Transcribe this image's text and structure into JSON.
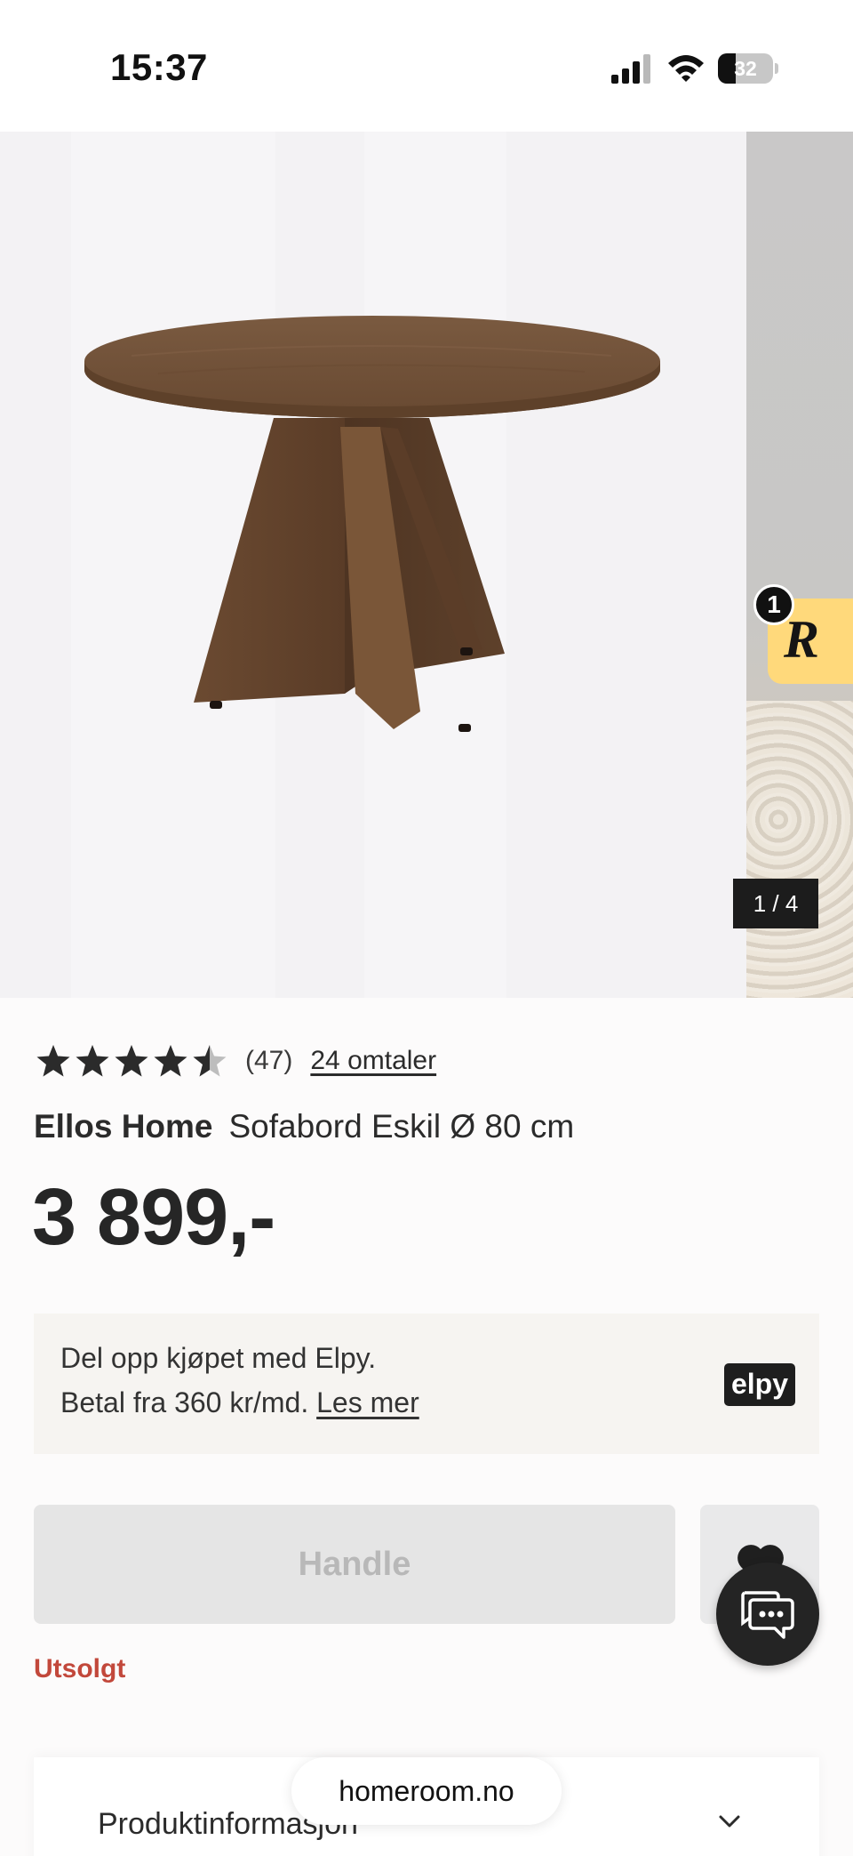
{
  "status_bar": {
    "time": "15:37",
    "battery_level": "32",
    "battery_fraction": 0.32,
    "icons": [
      "signal-icon",
      "wifi-icon",
      "battery-icon"
    ]
  },
  "gallery": {
    "counter": "1 / 4",
    "reco_badge_count": "1",
    "reco_logo": "R"
  },
  "rating": {
    "stars": 4.5,
    "count_text": "(47)",
    "reviews_link": "24 omtaler"
  },
  "product": {
    "brand": "Ellos Home",
    "name": "Sofabord Eskil Ø 80 cm",
    "price": "3 899,-"
  },
  "financing": {
    "line1": "Del opp kjøpet med Elpy.",
    "line2": "Betal fra 360 kr/md.",
    "link": "Les mer",
    "logo_text": "elpy"
  },
  "actions": {
    "buy_label": "Handle",
    "stock_status": "Utsolgt"
  },
  "info_section": {
    "title": "Produktinformasjon"
  },
  "browser": {
    "url": "homeroom.no"
  },
  "colors": {
    "sold_out": "#c2483b",
    "disabled_button": "#e5e5e5",
    "reco_widget": "#ffd97b",
    "wood": "#6b4a33"
  }
}
